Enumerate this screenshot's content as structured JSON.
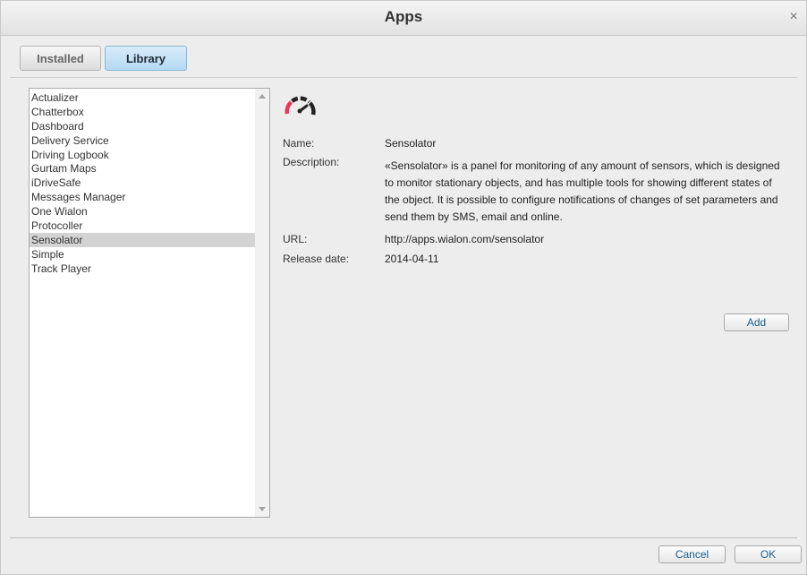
{
  "window": {
    "title": "Apps",
    "close_glyph": "×"
  },
  "tabs": [
    {
      "label": "Installed",
      "active": false
    },
    {
      "label": "Library",
      "active": true
    }
  ],
  "app_list": {
    "items": [
      "Actualizer",
      "Chatterbox",
      "Dashboard",
      "Delivery Service",
      "Driving Logbook",
      "Gurtam Maps",
      "iDriveSafe",
      "Messages Manager",
      "One Wialon",
      "Protocoller",
      "Sensolator",
      "Simple",
      "Track Player"
    ],
    "selected": "Sensolator"
  },
  "details": {
    "icon": "speedometer-icon",
    "name_label": "Name:",
    "name_value": "Sensolator",
    "description_label": "Description:",
    "description_value": "«Sensolator» is a panel for monitoring of any amount of sensors, which is designed to monitor stationary objects, and has multiple tools for showing different states of the object. It is possible to configure notifications of changes of set parameters and send them by SMS, email and online.",
    "url_label": "URL:",
    "url_value": "http://apps.wialon.com/sensolator",
    "release_label": "Release date:",
    "release_value": "2014-04-11",
    "add_label": "Add"
  },
  "footer": {
    "cancel_label": "Cancel",
    "ok_label": "OK"
  },
  "colors": {
    "selected_row": "#d3d3d3",
    "active_tab": "#b5d9f2",
    "icon_accent": "#e8365f",
    "link_text": "#1c5f8f"
  }
}
